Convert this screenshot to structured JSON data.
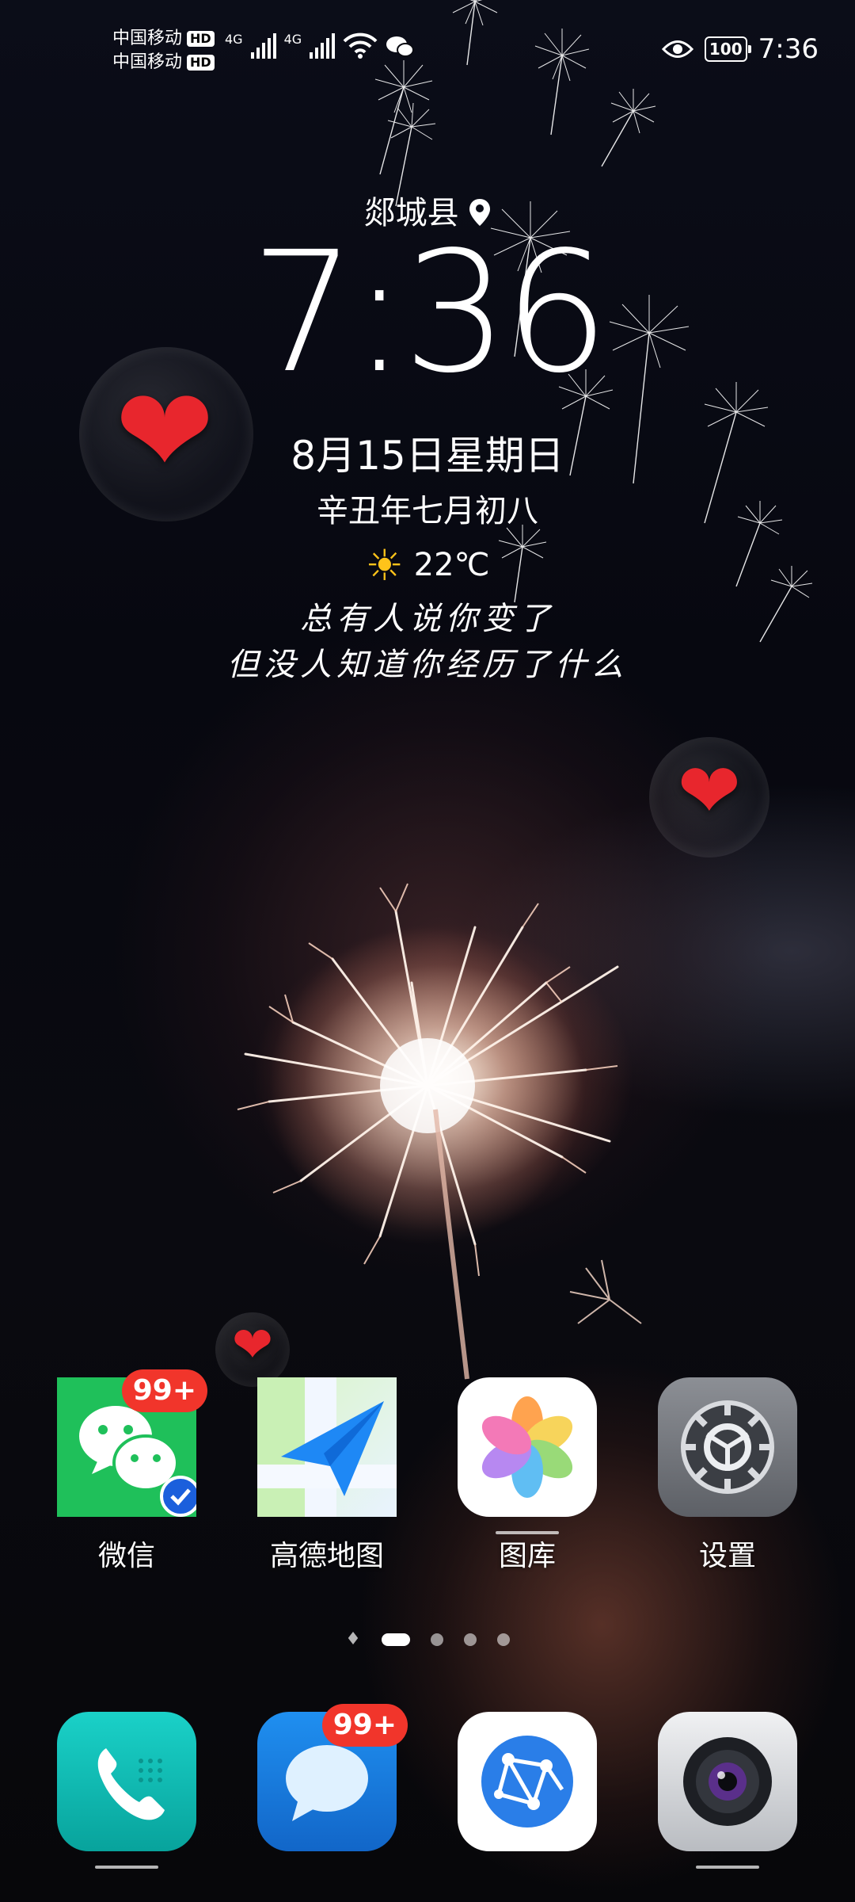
{
  "status_bar": {
    "carrier1": "中国移动",
    "carrier2": "中国移动",
    "hd": "HD",
    "net1": "4G",
    "net2": "4G",
    "battery": "100",
    "time": "7:36"
  },
  "widget": {
    "location": "郯城县",
    "time": "7:36",
    "date": "8月15日星期日",
    "lunar": "辛丑年七月初八",
    "temperature": "22℃",
    "quote_line1": "总有人说你变了",
    "quote_line2": "但没人知道你经历了什么"
  },
  "apps": [
    {
      "label": "微信",
      "badge": "99+",
      "icon": "wechat-icon"
    },
    {
      "label": "高德地图",
      "icon": "amap-icon"
    },
    {
      "label": "图库",
      "icon": "gallery-icon"
    },
    {
      "label": "设置",
      "icon": "settings-icon"
    }
  ],
  "dock": [
    {
      "name": "phone",
      "icon": "phone-icon"
    },
    {
      "name": "messages",
      "badge": "99+",
      "icon": "messages-icon"
    },
    {
      "name": "browser",
      "icon": "browser-icon"
    },
    {
      "name": "camera",
      "icon": "camera-icon"
    }
  ],
  "pages": {
    "count": 4,
    "active": 0
  }
}
